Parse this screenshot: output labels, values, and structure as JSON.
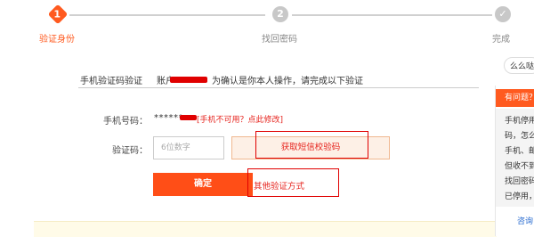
{
  "steps": [
    {
      "number": "1",
      "label": "验证身份",
      "state": "active"
    },
    {
      "number": "2",
      "label": "找回密码",
      "state": "pending"
    },
    {
      "number": "✓",
      "label": "完成",
      "state": "pending"
    }
  ],
  "verify": {
    "method_label": "手机验证码验证",
    "description_prefix": "账户",
    "description_suffix": "为确认是你本人操作，请完成以下验证"
  },
  "form": {
    "phone_label": "手机号码：",
    "phone_value": "******",
    "phone_unavailable_link": "[手机不可用？点此修改]",
    "code_label": "验证码：",
    "code_placeholder": "6位数字",
    "get_code_button": "获取短信校验码",
    "confirm_button": "确定",
    "other_method_link": "其他验证方式"
  },
  "help": {
    "ask_bubble": "么么哒",
    "title": "有问题？",
    "lines": [
      "手机停用",
      "码，怎么",
      "手机、邮",
      "但收不到",
      "找回密码",
      "已停用，"
    ],
    "consult": "咨询"
  },
  "colors": {
    "accent": "#ff5a1f",
    "link_red": "#e6231d",
    "annotation_red": "#e00000"
  }
}
